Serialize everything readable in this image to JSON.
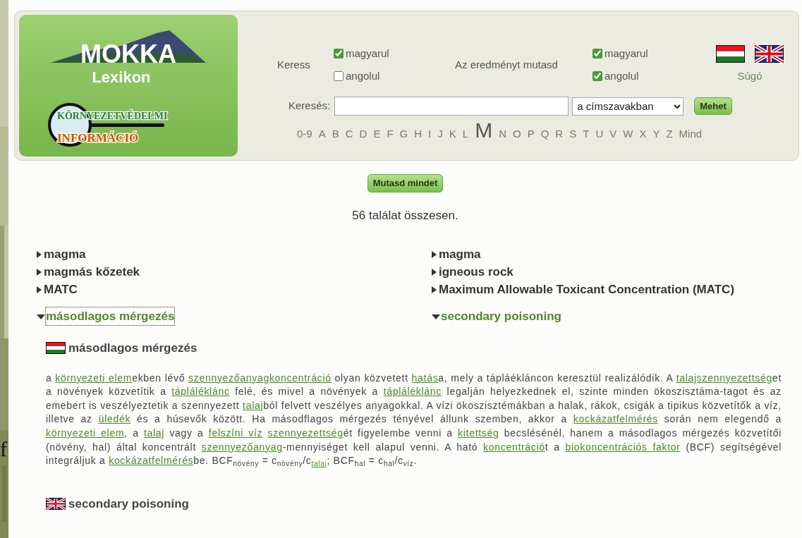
{
  "logo": {
    "title": "MOKKA",
    "subtitle": "Lexikon",
    "badge_top": "KÖRNYEZETVÉDELMI",
    "badge_bottom": "INFORMÁCIÓ"
  },
  "search_options": {
    "search_label": "Keress",
    "search_in": [
      {
        "label": "magyarul",
        "checked": true
      },
      {
        "label": "angolul",
        "checked": false
      }
    ],
    "show_label": "Az eredményt mutasd",
    "show_in": [
      {
        "label": "magyarul",
        "checked": true
      },
      {
        "label": "angolul",
        "checked": true
      }
    ],
    "help_link": "Súgó"
  },
  "search": {
    "label": "Keresés:",
    "scope": "a címszavakban",
    "button": "Mehet"
  },
  "alphabet": [
    {
      "label": "0-9",
      "selected": false
    },
    {
      "label": "A",
      "selected": false
    },
    {
      "label": "B",
      "selected": false
    },
    {
      "label": "C",
      "selected": false
    },
    {
      "label": "D",
      "selected": false
    },
    {
      "label": "E",
      "selected": false
    },
    {
      "label": "F",
      "selected": false
    },
    {
      "label": "G",
      "selected": false
    },
    {
      "label": "H",
      "selected": false
    },
    {
      "label": "I",
      "selected": false
    },
    {
      "label": "J",
      "selected": false
    },
    {
      "label": "K",
      "selected": false
    },
    {
      "label": "L",
      "selected": false
    },
    {
      "label": "M",
      "selected": true
    },
    {
      "label": "N",
      "selected": false
    },
    {
      "label": "O",
      "selected": false
    },
    {
      "label": "P",
      "selected": false
    },
    {
      "label": "Q",
      "selected": false
    },
    {
      "label": "R",
      "selected": false
    },
    {
      "label": "S",
      "selected": false
    },
    {
      "label": "T",
      "selected": false
    },
    {
      "label": "U",
      "selected": false
    },
    {
      "label": "V",
      "selected": false
    },
    {
      "label": "W",
      "selected": false
    },
    {
      "label": "X",
      "selected": false
    },
    {
      "label": "Y",
      "selected": false
    },
    {
      "label": "Z",
      "selected": false
    },
    {
      "label": "Mind",
      "selected": false
    }
  ],
  "show_all_button": "Mutasd mindet",
  "result_count": "56 találat összesen.",
  "results": [
    {
      "hu": {
        "text": "magma",
        "expanded": false,
        "focused": false
      },
      "en": {
        "text": "magma",
        "expanded": false
      }
    },
    {
      "hu": {
        "text": "magmás kőzetek",
        "expanded": false,
        "focused": false
      },
      "en": {
        "text": "igneous rock",
        "expanded": false
      }
    },
    {
      "hu": {
        "text": "MATC",
        "expanded": false,
        "focused": false
      },
      "en": {
        "text": "Maximum Allowable Toxicant Concentration (MATC)",
        "expanded": false
      }
    },
    {
      "hu": {
        "text": "másodlagos mérgezés",
        "expanded": true,
        "focused": true
      },
      "en": {
        "text": "secondary poisoning",
        "expanded": true
      }
    }
  ],
  "entry": {
    "hu_title": "másodlagos mérgezés",
    "en_title": "secondary poisoning",
    "definition": [
      {
        "kind": "text",
        "text": "a "
      },
      {
        "kind": "link",
        "text": "környezeti elem"
      },
      {
        "kind": "text",
        "text": "ekben lévő "
      },
      {
        "kind": "link",
        "text": "szennyezőanyagkoncentráció"
      },
      {
        "kind": "text",
        "text": " olyan közvetett "
      },
      {
        "kind": "link",
        "text": "hatás"
      },
      {
        "kind": "text",
        "text": "a, mely a tápláékláncon keresztül realizálódik. A "
      },
      {
        "kind": "link",
        "text": "talajszennyezettség"
      },
      {
        "kind": "text",
        "text": "et a növények közvetítik a "
      },
      {
        "kind": "link",
        "text": "tápláléklánc"
      },
      {
        "kind": "text",
        "text": " felé, és mivel a növények a "
      },
      {
        "kind": "link",
        "text": "tápláléklánc"
      },
      {
        "kind": "text",
        "text": " legalján helyezkednek el, szinte minden ökoszisztáma-tagot és az emebert is veszélyeztetik a szennyezett "
      },
      {
        "kind": "link",
        "text": "talaj"
      },
      {
        "kind": "text",
        "text": "ból felvett veszélyes anyagokkal. A vízi ökoszisztémákban a halak, rákok, csigák a tipikus közvetítők a víz, illetve az "
      },
      {
        "kind": "link",
        "text": "üledék"
      },
      {
        "kind": "text",
        "text": " és a húsevők között. Ha másodflagos mérgezés tényével állunk szemben, akkor a "
      },
      {
        "kind": "link",
        "text": "kockázatfelmérés"
      },
      {
        "kind": "text",
        "text": " során nem elegendő a "
      },
      {
        "kind": "link",
        "text": "környezeti elem"
      },
      {
        "kind": "text",
        "text": ", a "
      },
      {
        "kind": "link",
        "text": "talaj"
      },
      {
        "kind": "text",
        "text": " vagy a "
      },
      {
        "kind": "link",
        "text": "felszíni víz",
        "space_after": true
      },
      {
        "kind": "link",
        "text": "szennyezettség"
      },
      {
        "kind": "text",
        "text": "ét figyelembe venni a "
      },
      {
        "kind": "link",
        "text": "kitettség"
      },
      {
        "kind": "text",
        "text": " becslésénél, hanem a másodlagos mérgezés közvetítői (növény, hal) által koncentrált "
      },
      {
        "kind": "link",
        "text": "szennyezőanyag"
      },
      {
        "kind": "text",
        "text": "-mennyiséget kell alapul venni. A ható "
      },
      {
        "kind": "link",
        "text": "koncentráció"
      },
      {
        "kind": "text",
        "text": "t a "
      },
      {
        "kind": "link",
        "text": "biokoncentrációs faktor"
      },
      {
        "kind": "text",
        "text": " (BCF) segítségével integráljuk a "
      },
      {
        "kind": "link",
        "text": "kockázatfelmérés"
      },
      {
        "kind": "text",
        "text": "be. BCF"
      },
      {
        "kind": "sub",
        "text": "növény"
      },
      {
        "kind": "text",
        "text": " = c"
      },
      {
        "kind": "sub",
        "text": "növény"
      },
      {
        "kind": "text",
        "text": "/c"
      },
      {
        "kind": "sub_link",
        "text": "talaj"
      },
      {
        "kind": "text",
        "text": "; BCF"
      },
      {
        "kind": "sub",
        "text": "hal"
      },
      {
        "kind": "text",
        "text": " = c"
      },
      {
        "kind": "sub",
        "text": "hal"
      },
      {
        "kind": "text",
        "text": "/c"
      },
      {
        "kind": "sub",
        "text": "víz"
      },
      {
        "kind": "text",
        "text": "."
      }
    ]
  },
  "background_fragment": "f"
}
